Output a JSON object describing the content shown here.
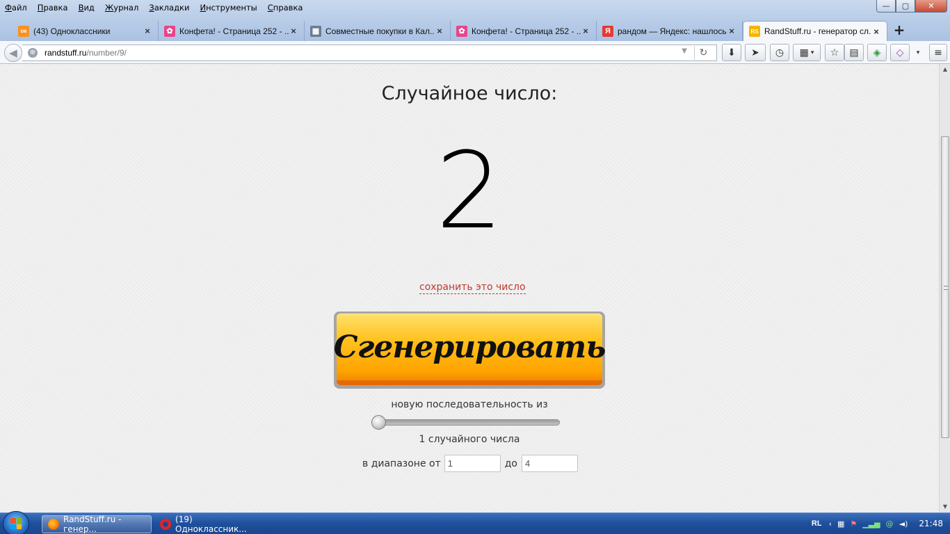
{
  "menu": [
    {
      "ul": "Ф",
      "rest": "айл"
    },
    {
      "ul": "П",
      "rest": "равка"
    },
    {
      "ul": "В",
      "rest": "ид"
    },
    {
      "ul": "Ж",
      "rest": "урнал"
    },
    {
      "ul": "З",
      "rest": "акладки"
    },
    {
      "ul": "И",
      "rest": "нструменты"
    },
    {
      "ul": "С",
      "rest": "правка"
    }
  ],
  "window_controls": {
    "minimize": "—",
    "restore": "▢",
    "close": "✕"
  },
  "tabs": [
    {
      "title": "(43) Одноклассники",
      "icon": "odnoklassniki-icon",
      "icon_char": "ок",
      "icon_color": "#f7931e"
    },
    {
      "title": "Конфета! - Страница 252 - ...",
      "icon": "konfeta-icon",
      "icon_char": "✿",
      "icon_color": "#e8458b"
    },
    {
      "title": "Совместные покупки в Кал...",
      "icon": "sp-icon",
      "icon_char": "▦",
      "icon_color": "#6b7c93"
    },
    {
      "title": "Конфета! - Страница 252 - ...",
      "icon": "konfeta-icon",
      "icon_char": "✿",
      "icon_color": "#e8458b"
    },
    {
      "title": "рандом — Яндекс: нашлось ...",
      "icon": "yandex-icon",
      "icon_char": "Я",
      "icon_color": "#e53935"
    },
    {
      "title": "RandStuff.ru - генератор сл...",
      "icon": "randstuff-icon",
      "icon_char": "RS",
      "icon_color": "#f5b400"
    }
  ],
  "new_tab_label": "+",
  "url": {
    "host": "randstuff.ru",
    "path": "/number/9/"
  },
  "page": {
    "heading": "Случайное число:",
    "number": "2",
    "save_link": "сохранить это число",
    "generate_button": "Сгенерировать",
    "sequence_label": "новую последовательность из",
    "slider_value": 1,
    "count_label": "1 случайного числа",
    "range_from_label": "в диапазоне от",
    "range_to_label": "до",
    "range_from": "1",
    "range_to": "4"
  },
  "taskbar": {
    "tasks": [
      {
        "label": "RandStuff.ru - генер...",
        "icon": "firefox-icon",
        "active": true
      },
      {
        "label": "(19) Одноклассник...",
        "icon": "opera-icon",
        "active": false
      }
    ],
    "language": "RL",
    "clock": "21:48"
  }
}
